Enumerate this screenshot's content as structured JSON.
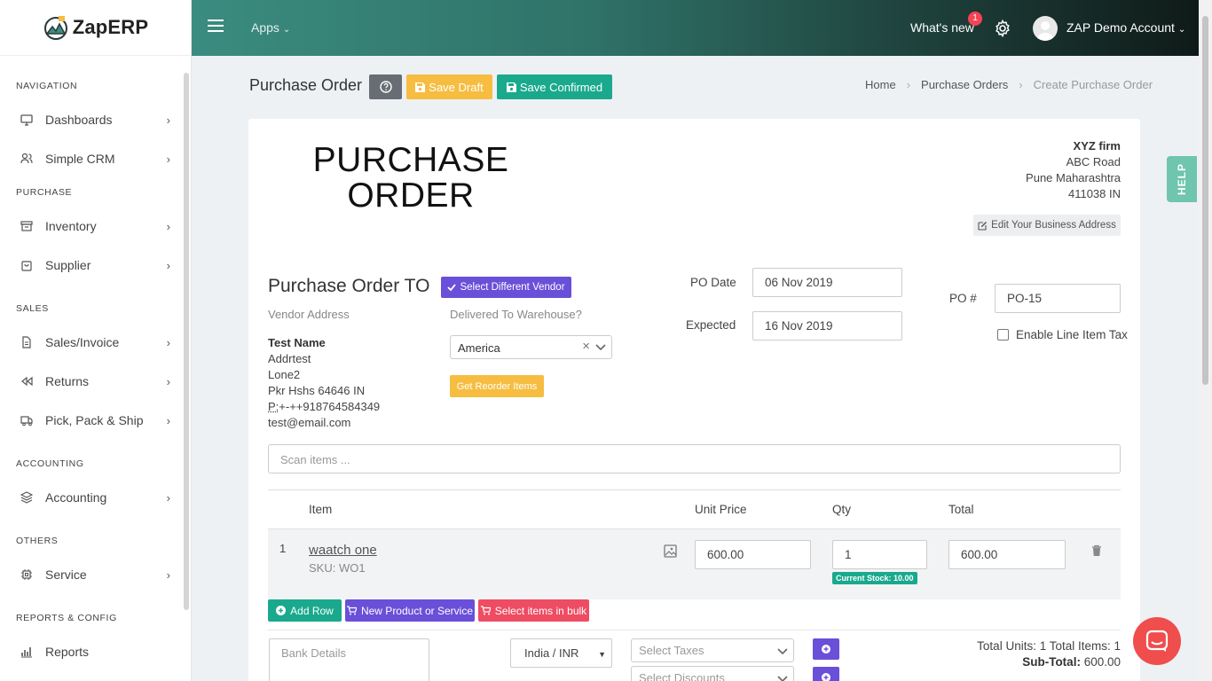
{
  "app": {
    "name": "ZapERP"
  },
  "topbar": {
    "apps_label": "Apps",
    "whats_new": "What's new",
    "whats_new_count": "1",
    "account": "ZAP Demo Account"
  },
  "sidebar": {
    "sections": [
      {
        "label": "NAVIGATION"
      },
      {
        "label": "PURCHASE"
      },
      {
        "label": "SALES"
      },
      {
        "label": "ACCOUNTING"
      },
      {
        "label": "OTHERS"
      },
      {
        "label": "REPORTS & CONFIG"
      }
    ],
    "items": [
      {
        "label": "Dashboards",
        "icon": "monitor-icon"
      },
      {
        "label": "Simple CRM",
        "icon": "users-icon"
      },
      {
        "label": "Inventory",
        "icon": "archive-icon"
      },
      {
        "label": "Supplier",
        "icon": "shopping-bag-icon"
      },
      {
        "label": "Sales/Invoice",
        "icon": "file-icon"
      },
      {
        "label": "Returns",
        "icon": "rewind-icon"
      },
      {
        "label": "Pick, Pack & Ship",
        "icon": "truck-icon"
      },
      {
        "label": "Accounting",
        "icon": "layers-icon"
      },
      {
        "label": "Service",
        "icon": "cpu-icon"
      },
      {
        "label": "Reports",
        "icon": "bar-chart-icon"
      }
    ]
  },
  "header": {
    "title": "Purchase Order",
    "save_draft": "Save Draft",
    "save_confirmed": "Save Confirmed",
    "breadcrumb": [
      "Home",
      "Purchase Orders",
      "Create Purchase Order"
    ]
  },
  "document": {
    "heading_line1": "PURCHASE",
    "heading_line2": "ORDER",
    "business": {
      "name": "XYZ firm",
      "line1": "ABC Road",
      "line2": "Pune Maharashtra",
      "line3": "411038 IN"
    },
    "edit_address": "Edit Your Business Address",
    "po_to": "Purchase Order TO",
    "select_vendor": "Select Different Vendor",
    "vendor_address_label": "Vendor Address",
    "warehouse_label": "Delivered To Warehouse?",
    "vendor": {
      "name": "Test Name",
      "line1": "Addrtest",
      "line2": "Lone2",
      "line3": "Pkr Hshs 64646 IN",
      "phone_prefix": "P:",
      "phone": "+-++918764584349",
      "email": "test@email.com"
    },
    "warehouse": "America",
    "get_reorder": "Get Reorder Items",
    "po_date_label": "PO Date",
    "po_date": "06 Nov 2019",
    "expected_label": "Expected",
    "expected": "16 Nov 2019",
    "po_number_label": "PO #",
    "po_number": "PO-15",
    "line_item_tax": "Enable Line Item Tax",
    "scan_placeholder": "Scan items ..."
  },
  "table": {
    "columns": [
      "Item",
      "Unit Price",
      "Qty",
      "Total"
    ],
    "rows": [
      {
        "num": "1",
        "name": "waatch one",
        "sku": "SKU: WO1",
        "unit_price": "600.00",
        "qty": "1",
        "stock": "Current Stock: 10.00",
        "total": "600.00"
      }
    ]
  },
  "actions": {
    "add_row": "Add Row",
    "new_product": "New Product or Service",
    "select_bulk": "Select items in bulk"
  },
  "footer": {
    "bank_placeholder": "Bank Details",
    "currency": "India / INR",
    "taxes_placeholder": "Select Taxes",
    "discounts_placeholder": "Select Discounts",
    "total_units": "Total Units: 1 Total Items: 1",
    "subtotal_label": "Sub-Total:",
    "subtotal": "600.00"
  },
  "help_tab": "HELP",
  "colors": {
    "primary": "#1aa98d",
    "warning": "#f6bd41",
    "purple": "#6a4fd8",
    "danger": "#ee4c63",
    "chat": "#f04d4d"
  }
}
